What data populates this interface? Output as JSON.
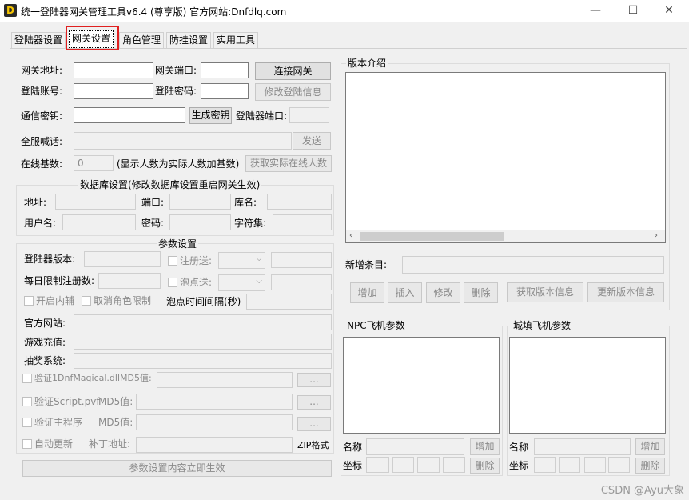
{
  "window": {
    "logo_letter": "D",
    "title": "统一登陆器网关管理工具v6.4 (尊享版)   官方网站:Dnfdlq.com",
    "minimize": "—",
    "maximize": "☐",
    "close": "✕"
  },
  "tabs": [
    "登陆器设置",
    "网关设置",
    "角色管理",
    "防挂设置",
    "实用工具"
  ],
  "gateway": {
    "address_label": "网关地址:",
    "port_label": "网关端口:",
    "connect_button": "连接网关",
    "account_label": "登陆账号:",
    "password_label": "登陆密码:",
    "modify_login_button": "修改登陆信息",
    "key_label": "通信密钥:",
    "gen_key_button": "生成密钥",
    "launcher_port_label": "登陆器端口:",
    "broadcast_label": "全服喊话:",
    "send_button": "发送",
    "online_base_label": "在线基数:",
    "online_base_value": "0",
    "online_hint": "(显示人数为实际人数加基数)",
    "get_online_button": "获取实际在线人数"
  },
  "database": {
    "title": "数据库设置(修改数据库设置重启网关生效)",
    "address_label": "地址:",
    "port_label": "端口:",
    "dbname_label": "库名:",
    "user_label": "用户名:",
    "password_label": "密码:",
    "charset_label": "字符集:"
  },
  "params": {
    "title": "参数设置",
    "launcher_version_label": "登陆器版本:",
    "register_gift_label": "注册送:",
    "daily_limit_label": "每日限制注册数:",
    "bubble_gift_label": "泡点送:",
    "enable_assist_label": "开启内辅",
    "cancel_role_limit_label": "取消角色限制",
    "bubble_interval_label": "泡点时间间隔(秒)",
    "website_label": "官方网站:",
    "recharge_label": "游戏充值:",
    "lottery_label": "抽奖系统:",
    "verify_dll_label": "验证1DnfMagical.dll",
    "verify_pvf_label": "验证Script.pvf",
    "verify_main_label": "验证主程序",
    "md5_label": "MD5值:",
    "browse_button": "...",
    "auto_update_label": "自动更新",
    "patch_address_label": "补丁地址:",
    "zip_format_label": "ZIP格式",
    "apply_button": "参数设置内容立即生效"
  },
  "version": {
    "title": "版本介绍",
    "new_entry_label": "新增条目:",
    "add_button": "增加",
    "insert_button": "插入",
    "modify_button": "修改",
    "delete_button": "删除",
    "get_version_button": "获取版本信息",
    "update_version_button": "更新版本信息"
  },
  "npc_flight": {
    "title": "NPC飞机参数",
    "name_label": "名称",
    "add_button": "增加",
    "coord_label": "坐标",
    "delete_button": "删除"
  },
  "town_flight": {
    "title": "城填飞机参数",
    "name_label": "名称",
    "add_button": "增加",
    "coord_label": "坐标",
    "delete_button": "删除"
  },
  "watermark": "CSDN @Ayu大象"
}
